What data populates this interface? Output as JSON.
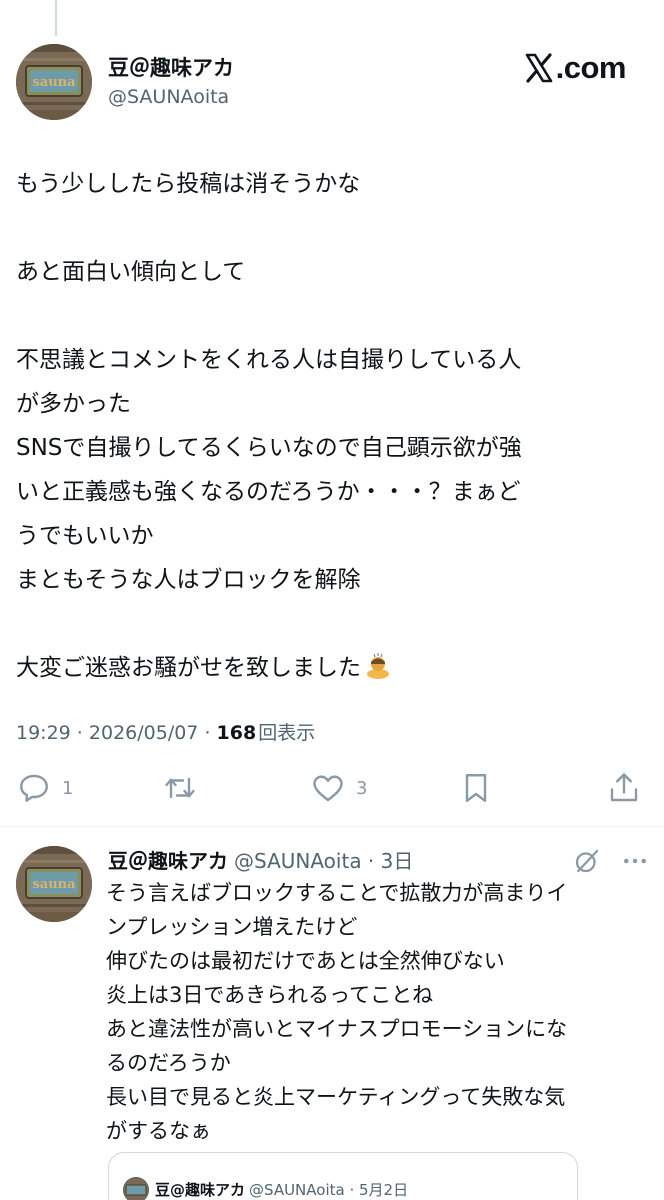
{
  "main_tweet": {
    "author_name": "豆＠趣味アカ",
    "author_handle": "@SAUNAoita",
    "brand": ".com",
    "lines": [
      "もう少ししたら投稿は消そうかな",
      "",
      "あと面白い傾向として",
      "",
      "不思議とコメントをくれる人は自撮りしている人",
      "が多かった",
      "SNSで自撮りしてるくらいなので自己顕示欲が強",
      "いと正義感も強くなるのだろうか・・・？まぁど",
      "うでもいいか",
      "まともそうな人はブロックを解除",
      "",
      "大変ご迷惑お騒がせを致しました"
    ],
    "time": "19:29",
    "date": "2026/05/07",
    "separator": " · ",
    "views_count": "168",
    "views_label": "回表示",
    "actions": {
      "reply_count": "1",
      "retweet_count": "",
      "like_count": "3"
    },
    "icons": [
      "reply-icon",
      "retweet-icon",
      "like-icon",
      "bookmark-icon",
      "share-icon"
    ]
  },
  "reply_tweet": {
    "author_name": "豆＠趣味アカ",
    "author_handle": "@SAUNAoita · 3日",
    "lines": [
      "そう言えばブロックすることで拡散力が高まりイ",
      "ンプレッション増えたけど",
      "伸びたのは最初だけであとは全然伸びない",
      "炎上は3日であきられるってことね",
      "あと違法性が高いとマイナスプロモーションにな",
      "るのだろうか",
      "長い目で見ると炎上マーケティングって失敗な気",
      "がするなぁ"
    ],
    "icons": [
      "grok-icon",
      "more-icon"
    ]
  },
  "quoted_tweet": {
    "author_name": "豆@趣味アカ",
    "author_handle": "@SAUNAoita · 5月2日"
  },
  "avatar_text": "sauna",
  "colors": {
    "text_primary": "#0f1419",
    "text_secondary": "#536471",
    "icon": "#8b98a5",
    "border": "#cfd9de"
  }
}
